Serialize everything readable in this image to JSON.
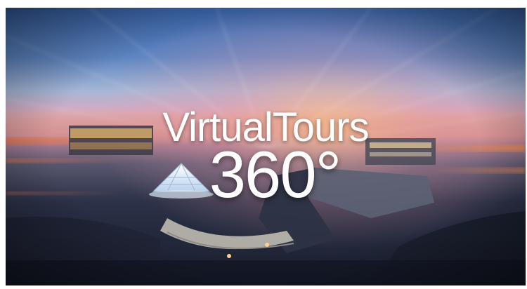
{
  "banner": {
    "title": "VirtualTours",
    "subtitle": "360°"
  },
  "colors": {
    "sky_top": "#3f6fb5",
    "sky_mid": "#8fa7cf",
    "sunset_pink": "#e9a5b8",
    "sunset_orange": "#f0b27a",
    "ground_dark": "#1b2132",
    "text": "#ffffff"
  },
  "icons": {
    "dome": "glass-dome-skylight",
    "building": "building-with-lit-windows"
  }
}
